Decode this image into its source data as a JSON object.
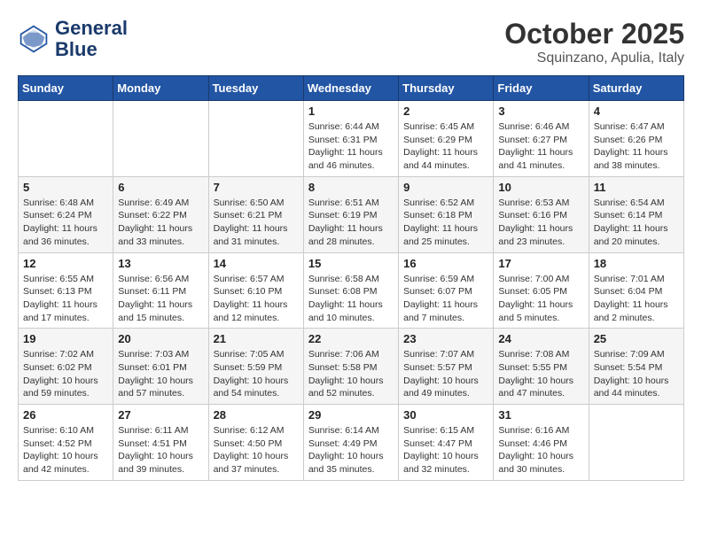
{
  "header": {
    "logo_line1": "General",
    "logo_line2": "Blue",
    "month": "October 2025",
    "location": "Squinzano, Apulia, Italy"
  },
  "weekdays": [
    "Sunday",
    "Monday",
    "Tuesday",
    "Wednesday",
    "Thursday",
    "Friday",
    "Saturday"
  ],
  "weeks": [
    [
      {
        "day": "",
        "info": ""
      },
      {
        "day": "",
        "info": ""
      },
      {
        "day": "",
        "info": ""
      },
      {
        "day": "1",
        "info": "Sunrise: 6:44 AM\nSunset: 6:31 PM\nDaylight: 11 hours\nand 46 minutes."
      },
      {
        "day": "2",
        "info": "Sunrise: 6:45 AM\nSunset: 6:29 PM\nDaylight: 11 hours\nand 44 minutes."
      },
      {
        "day": "3",
        "info": "Sunrise: 6:46 AM\nSunset: 6:27 PM\nDaylight: 11 hours\nand 41 minutes."
      },
      {
        "day": "4",
        "info": "Sunrise: 6:47 AM\nSunset: 6:26 PM\nDaylight: 11 hours\nand 38 minutes."
      }
    ],
    [
      {
        "day": "5",
        "info": "Sunrise: 6:48 AM\nSunset: 6:24 PM\nDaylight: 11 hours\nand 36 minutes."
      },
      {
        "day": "6",
        "info": "Sunrise: 6:49 AM\nSunset: 6:22 PM\nDaylight: 11 hours\nand 33 minutes."
      },
      {
        "day": "7",
        "info": "Sunrise: 6:50 AM\nSunset: 6:21 PM\nDaylight: 11 hours\nand 31 minutes."
      },
      {
        "day": "8",
        "info": "Sunrise: 6:51 AM\nSunset: 6:19 PM\nDaylight: 11 hours\nand 28 minutes."
      },
      {
        "day": "9",
        "info": "Sunrise: 6:52 AM\nSunset: 6:18 PM\nDaylight: 11 hours\nand 25 minutes."
      },
      {
        "day": "10",
        "info": "Sunrise: 6:53 AM\nSunset: 6:16 PM\nDaylight: 11 hours\nand 23 minutes."
      },
      {
        "day": "11",
        "info": "Sunrise: 6:54 AM\nSunset: 6:14 PM\nDaylight: 11 hours\nand 20 minutes."
      }
    ],
    [
      {
        "day": "12",
        "info": "Sunrise: 6:55 AM\nSunset: 6:13 PM\nDaylight: 11 hours\nand 17 minutes."
      },
      {
        "day": "13",
        "info": "Sunrise: 6:56 AM\nSunset: 6:11 PM\nDaylight: 11 hours\nand 15 minutes."
      },
      {
        "day": "14",
        "info": "Sunrise: 6:57 AM\nSunset: 6:10 PM\nDaylight: 11 hours\nand 12 minutes."
      },
      {
        "day": "15",
        "info": "Sunrise: 6:58 AM\nSunset: 6:08 PM\nDaylight: 11 hours\nand 10 minutes."
      },
      {
        "day": "16",
        "info": "Sunrise: 6:59 AM\nSunset: 6:07 PM\nDaylight: 11 hours\nand 7 minutes."
      },
      {
        "day": "17",
        "info": "Sunrise: 7:00 AM\nSunset: 6:05 PM\nDaylight: 11 hours\nand 5 minutes."
      },
      {
        "day": "18",
        "info": "Sunrise: 7:01 AM\nSunset: 6:04 PM\nDaylight: 11 hours\nand 2 minutes."
      }
    ],
    [
      {
        "day": "19",
        "info": "Sunrise: 7:02 AM\nSunset: 6:02 PM\nDaylight: 10 hours\nand 59 minutes."
      },
      {
        "day": "20",
        "info": "Sunrise: 7:03 AM\nSunset: 6:01 PM\nDaylight: 10 hours\nand 57 minutes."
      },
      {
        "day": "21",
        "info": "Sunrise: 7:05 AM\nSunset: 5:59 PM\nDaylight: 10 hours\nand 54 minutes."
      },
      {
        "day": "22",
        "info": "Sunrise: 7:06 AM\nSunset: 5:58 PM\nDaylight: 10 hours\nand 52 minutes."
      },
      {
        "day": "23",
        "info": "Sunrise: 7:07 AM\nSunset: 5:57 PM\nDaylight: 10 hours\nand 49 minutes."
      },
      {
        "day": "24",
        "info": "Sunrise: 7:08 AM\nSunset: 5:55 PM\nDaylight: 10 hours\nand 47 minutes."
      },
      {
        "day": "25",
        "info": "Sunrise: 7:09 AM\nSunset: 5:54 PM\nDaylight: 10 hours\nand 44 minutes."
      }
    ],
    [
      {
        "day": "26",
        "info": "Sunrise: 6:10 AM\nSunset: 4:52 PM\nDaylight: 10 hours\nand 42 minutes."
      },
      {
        "day": "27",
        "info": "Sunrise: 6:11 AM\nSunset: 4:51 PM\nDaylight: 10 hours\nand 39 minutes."
      },
      {
        "day": "28",
        "info": "Sunrise: 6:12 AM\nSunset: 4:50 PM\nDaylight: 10 hours\nand 37 minutes."
      },
      {
        "day": "29",
        "info": "Sunrise: 6:14 AM\nSunset: 4:49 PM\nDaylight: 10 hours\nand 35 minutes."
      },
      {
        "day": "30",
        "info": "Sunrise: 6:15 AM\nSunset: 4:47 PM\nDaylight: 10 hours\nand 32 minutes."
      },
      {
        "day": "31",
        "info": "Sunrise: 6:16 AM\nSunset: 4:46 PM\nDaylight: 10 hours\nand 30 minutes."
      },
      {
        "day": "",
        "info": ""
      }
    ]
  ]
}
